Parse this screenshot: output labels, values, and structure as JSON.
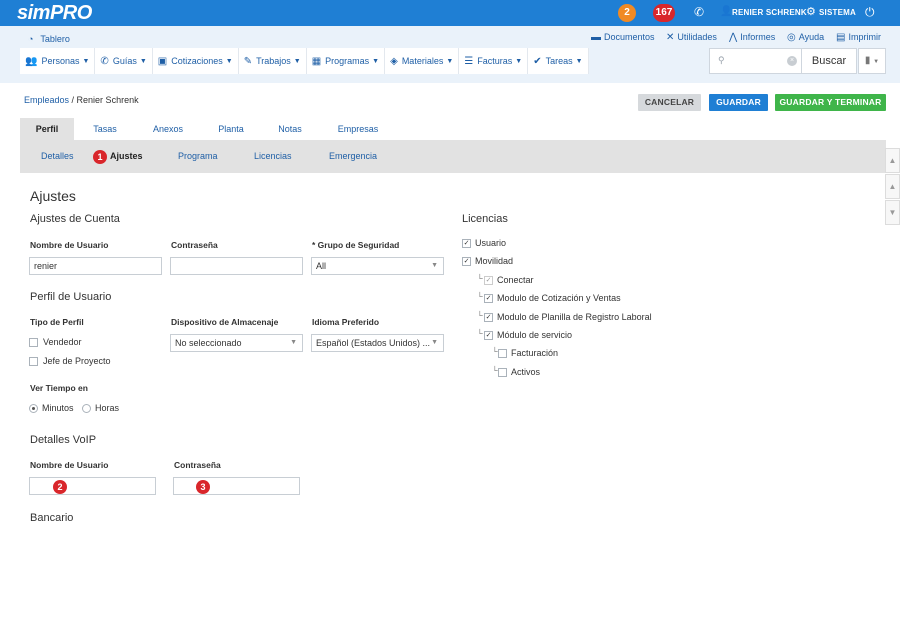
{
  "topbar": {
    "logo_sim": "sim",
    "logo_pro": "PRO",
    "badge_notifications": "2",
    "badge_messages": "167",
    "user_name": "RENIER SCHRENK",
    "system_label": "SISTEMA"
  },
  "nav": {
    "dashboard": "Tablero",
    "utilities": [
      "Documentos",
      "Utilidades",
      "Informes",
      "Ayuda",
      "Imprimir"
    ],
    "menu": [
      "Personas",
      "Guías",
      "Cotizaciones",
      "Trabajos",
      "Programas",
      "Materiales",
      "Facturas",
      "Tareas"
    ],
    "search_placeholder": "",
    "search_button": "Buscar"
  },
  "breadcrumb": {
    "parent": "Empleados",
    "separator": " / ",
    "current": "Renier Schrenk"
  },
  "actions": {
    "cancel": "CANCELAR",
    "save": "GUARDAR",
    "save_end": "GUARDAR Y TERMINAR"
  },
  "tabs": [
    "Perfil",
    "Tasas",
    "Anexos",
    "Planta",
    "Notas",
    "Empresas"
  ],
  "subtabs": [
    "Detalles",
    "Ajustes",
    "Programa",
    "Licencias",
    "Emergencia"
  ],
  "markers": [
    "1",
    "2",
    "3"
  ],
  "form": {
    "title": "Ajustes",
    "account": {
      "title": "Ajustes de Cuenta",
      "username_label": "Nombre de Usuario",
      "username_value": "renier",
      "password_label": "Contraseña",
      "password_value": "",
      "security_label": "* Grupo de Seguridad",
      "security_value": "All"
    },
    "profile": {
      "title": "Perfil de Usuario",
      "type_label": "Tipo de Perfil",
      "types": [
        "Vendedor",
        "Jefe de Proyecto"
      ],
      "device_label": "Dispositivo de Almacenaje",
      "device_value": "No seleccionado",
      "language_label": "Idioma Preferido",
      "language_value": "Español (Estados Unidos) ...",
      "time_label": "Ver Tiempo en",
      "time_options": [
        "Minutos",
        "Horas"
      ],
      "time_selected": "Minutos"
    },
    "voip": {
      "title": "Detalles VoIP",
      "username_label": "Nombre de Usuario",
      "username_value": "",
      "password_label": "Contraseña",
      "password_value": ""
    },
    "banking": {
      "title": "Bancario"
    },
    "licenses": {
      "title": "Licencias",
      "items": [
        {
          "label": "Usuario",
          "checked": true
        },
        {
          "label": "Movilidad",
          "checked": true
        },
        {
          "label": "Conectar",
          "checked": true
        },
        {
          "label": "Modulo de Cotización y Ventas",
          "checked": true
        },
        {
          "label": "Modulo de Planilla de Registro Laboral",
          "checked": true
        },
        {
          "label": "Módulo de servicio",
          "checked": true
        },
        {
          "label": "Facturación",
          "checked": false
        },
        {
          "label": "Activos",
          "checked": false
        }
      ]
    }
  }
}
